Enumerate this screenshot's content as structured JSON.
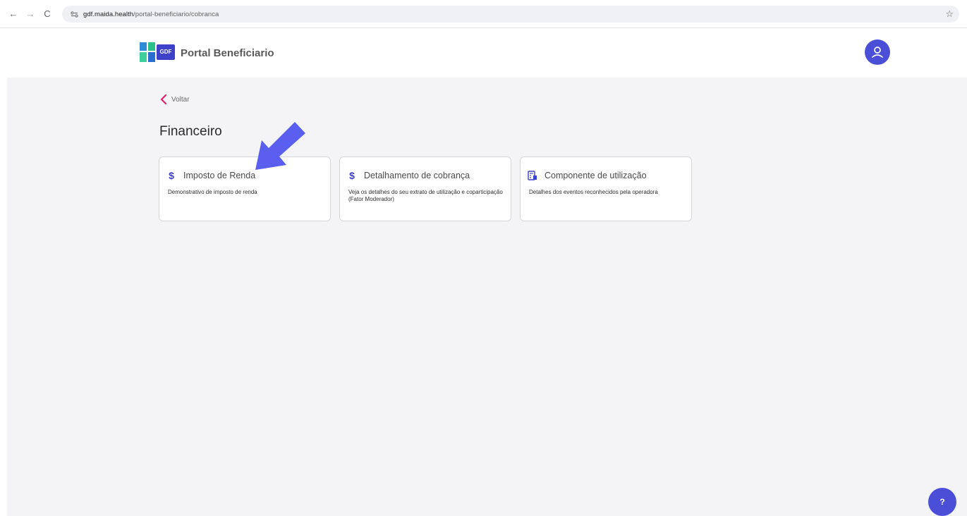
{
  "browser": {
    "url_host": "gdf.maida.health",
    "url_path": "/portal-beneficiario/cobranca"
  },
  "header": {
    "logo_text": "GDF",
    "title": "Portal Beneficiario"
  },
  "main": {
    "back_label": "Voltar",
    "page_title": "Financeiro",
    "cards": [
      {
        "icon": "dollar-icon",
        "title": "Imposto de Renda",
        "description": "Demonstrativo de imposto de renda"
      },
      {
        "icon": "dollar-icon",
        "title": "Detalhamento de cobrança",
        "description": "Veja os detalhes do seu extrato de utilização e coparticipação (Fator Moderador)"
      },
      {
        "icon": "calculator-document-icon",
        "title": "Componente de utilização",
        "description": "Detalhes dos eventos reconhecidos pela operadora"
      }
    ]
  },
  "help": {
    "label": "?"
  },
  "colors": {
    "accent": "#4b4fd8",
    "back_chevron": "#e0246b",
    "arrow": "#5b5ff0"
  }
}
